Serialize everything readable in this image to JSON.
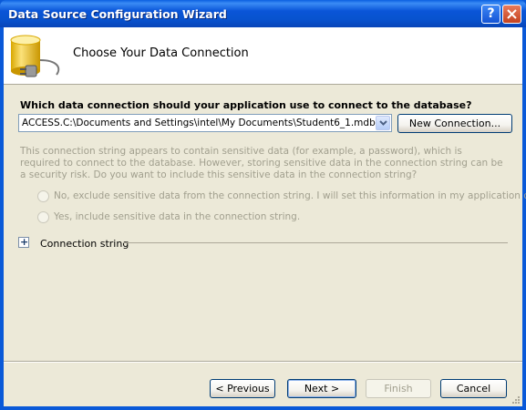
{
  "window": {
    "title": "Data Source Configuration Wizard",
    "help_label": "?"
  },
  "header": {
    "title": "Choose Your Data Connection",
    "icon": "database-plug-icon"
  },
  "connection": {
    "question": "Which data connection should your application use to connect to the database?",
    "selected": "ACCESS.C:\\Documents and Settings\\intel\\My Documents\\Student6_1.mdb",
    "new_connection_label": "New Connection..."
  },
  "sensitive": {
    "message": "This connection string appears to contain sensitive data (for example, a password), which is required to connect to the database. However, storing sensitive data in the connection string can be a security risk. Do you want to include this sensitive data in the connection string?",
    "option_no": "No, exclude sensitive data from the connection string. I will set this information in my application code.",
    "option_yes": "Yes, include sensitive data in the connection string."
  },
  "connection_string": {
    "expander_symbol": "+",
    "label": "Connection string"
  },
  "footer": {
    "previous_label": "< Previous",
    "next_label": "Next >",
    "finish_label": "Finish",
    "cancel_label": "Cancel"
  },
  "colors": {
    "titlebar": "#0a55d8",
    "dialog_bg": "#ece9d8",
    "disabled_text": "#a19f8e"
  }
}
